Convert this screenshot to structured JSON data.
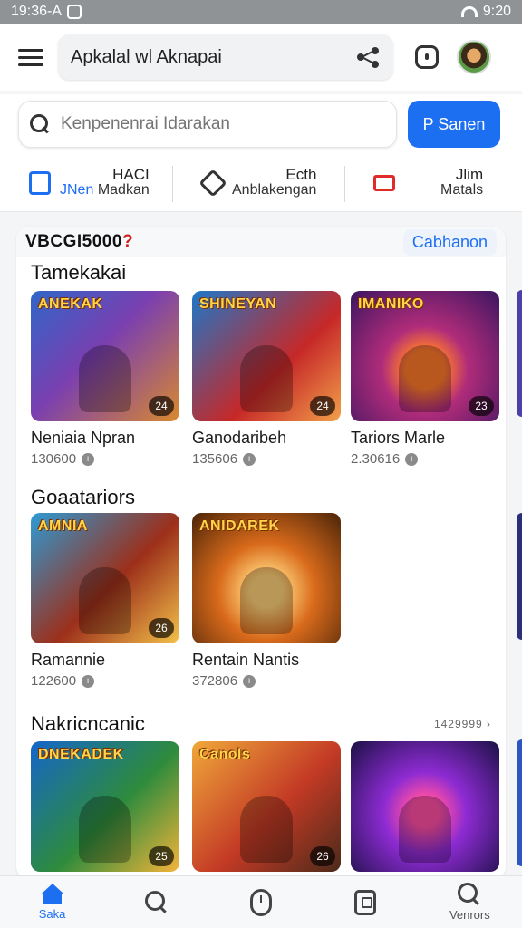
{
  "status": {
    "time_left": "19:36-A",
    "time_right": "9:20"
  },
  "header": {
    "title": "Apkalal wl Aknapai"
  },
  "search": {
    "placeholder": "Kenpenenrai Idarakan",
    "button_label": "P Sanen"
  },
  "quick_actions": [
    {
      "top": "HACI",
      "bottom_prefix": "JNen",
      "bottom_suffix": "Madkan"
    },
    {
      "top": "Ecth",
      "bottom": "Anblakengan"
    },
    {
      "top": "Jlim",
      "bottom": "Matals"
    }
  ],
  "card": {
    "code": "VBCGI5000",
    "code_mark": "?",
    "link": "Cabhanon"
  },
  "sections": [
    {
      "title": "Tamekakai",
      "more": "",
      "games": [
        {
          "name": "Neniaia Npran",
          "count": "130600",
          "badge": "24",
          "logo": "ANEKAK"
        },
        {
          "name": "Ganodaribeh",
          "count": "135606",
          "badge": "24",
          "logo": "SHINEYAN"
        },
        {
          "name": "Tariors Marle",
          "count": "2.30616",
          "badge": "23",
          "logo": "IMANIKO"
        }
      ]
    },
    {
      "title": "Goaatariors",
      "more": "",
      "games": [
        {
          "name": "Ramannie",
          "count": "122600",
          "badge": "26",
          "logo": "AMNIA"
        },
        {
          "name": "Rentain Nantis",
          "count": "372806",
          "badge": "",
          "logo": "ANIDAREK"
        }
      ]
    },
    {
      "title": "Nakricncanic",
      "more": "1429999 ›",
      "games": [
        {
          "name": "",
          "count": "",
          "badge": "25",
          "logo": "DNEKADEK"
        },
        {
          "name": "",
          "count": "",
          "badge": "26",
          "logo": "Canols"
        },
        {
          "name": "",
          "count": "",
          "badge": "",
          "logo": ""
        }
      ]
    }
  ],
  "bottom_nav": [
    {
      "label": "Saka",
      "icon": "home-icon",
      "active": true
    },
    {
      "label": "",
      "icon": "search-icon",
      "active": false
    },
    {
      "label": "",
      "icon": "mouse-icon",
      "active": false
    },
    {
      "label": "",
      "icon": "tablet-icon",
      "active": false
    },
    {
      "label": "Venrors",
      "icon": "search-icon",
      "active": false
    }
  ],
  "colors": {
    "accent": "#1d6ff2",
    "status_bar": "#8f9396",
    "alert": "#d11d1d"
  }
}
